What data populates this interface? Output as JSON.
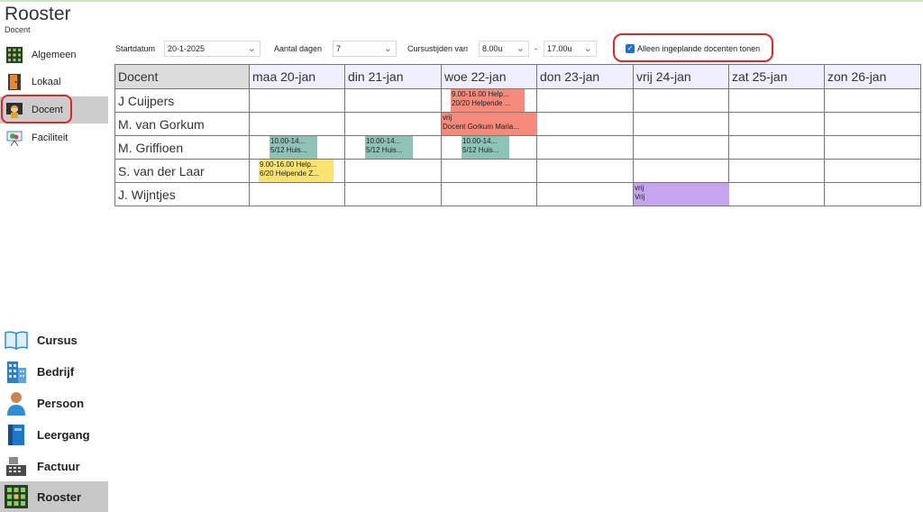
{
  "app": {
    "title": "Rooster",
    "subtitle": "Docent"
  },
  "sidebar": {
    "items": [
      {
        "label": "Algemeen",
        "icon": "grid-icon"
      },
      {
        "label": "Lokaal",
        "icon": "door-icon"
      },
      {
        "label": "Docent",
        "icon": "teacher-icon",
        "selected": true
      },
      {
        "label": "Faciliteit",
        "icon": "projector-icon"
      }
    ],
    "modules": [
      {
        "label": "Cursus",
        "icon": "book-icon"
      },
      {
        "label": "Bedrijf",
        "icon": "building-icon"
      },
      {
        "label": "Persoon",
        "icon": "person-icon"
      },
      {
        "label": "Leergang",
        "icon": "binder-icon"
      },
      {
        "label": "Factuur",
        "icon": "cash-register-icon"
      },
      {
        "label": "Rooster",
        "icon": "schedule-grid-icon",
        "selected": true
      }
    ]
  },
  "toolbar": {
    "startdatum_label": "Startdatum",
    "startdatum_value": "20-1-2025",
    "aantal_dagen_label": "Aantal dagen",
    "aantal_dagen_value": "7",
    "cursustijden_label": "Cursustijden van",
    "time_from": "8.00u",
    "separator": "-",
    "time_to": "17.00u",
    "checkbox_label": "Alleen ingeplande docenten tonen",
    "checkbox_checked": true
  },
  "grid": {
    "header_first": "Docent",
    "days": [
      "maa 20-jan",
      "din 21-jan",
      "woe 22-jan",
      "don 23-jan",
      "vrij 24-jan",
      "zat 25-jan",
      "zon 26-jan"
    ],
    "rows": [
      {
        "name": "J Cuijpers"
      },
      {
        "name": "M. van Gorkum"
      },
      {
        "name": "M. Griffioen"
      },
      {
        "name": "S. van der Laar"
      },
      {
        "name": "J. Wijntjes"
      }
    ],
    "events": [
      {
        "row": 0,
        "day": 2,
        "color": "red",
        "line1": "9.00-16.00 Help...",
        "line2": "20/20 Helpende ..."
      },
      {
        "row": 1,
        "day": 2,
        "color": "red",
        "line1": "vrij",
        "line2": "Docent Gorkum Maria..."
      },
      {
        "row": 2,
        "day": 0,
        "color": "teal",
        "line1": "10.00-14...",
        "line2": "5/12 Huis..."
      },
      {
        "row": 2,
        "day": 1,
        "color": "teal",
        "line1": "10.00-14...",
        "line2": "5/12 Huis..."
      },
      {
        "row": 2,
        "day": 2,
        "color": "teal",
        "line1": "10.00-14...",
        "line2": "5/12 Huis..."
      },
      {
        "row": 3,
        "day": 0,
        "color": "yellow",
        "line1": "9.00-16.00 Help...",
        "line2": "6/20 Helpende Z..."
      },
      {
        "row": 4,
        "day": 4,
        "color": "purple",
        "line1": "vrij",
        "line2": "Vrij"
      }
    ]
  },
  "colors": {
    "red": "#f58a7b",
    "teal": "#8dc3b7",
    "yellow": "#fbe36f",
    "purple": "#c5a4f0",
    "highlight": "#e22525"
  }
}
